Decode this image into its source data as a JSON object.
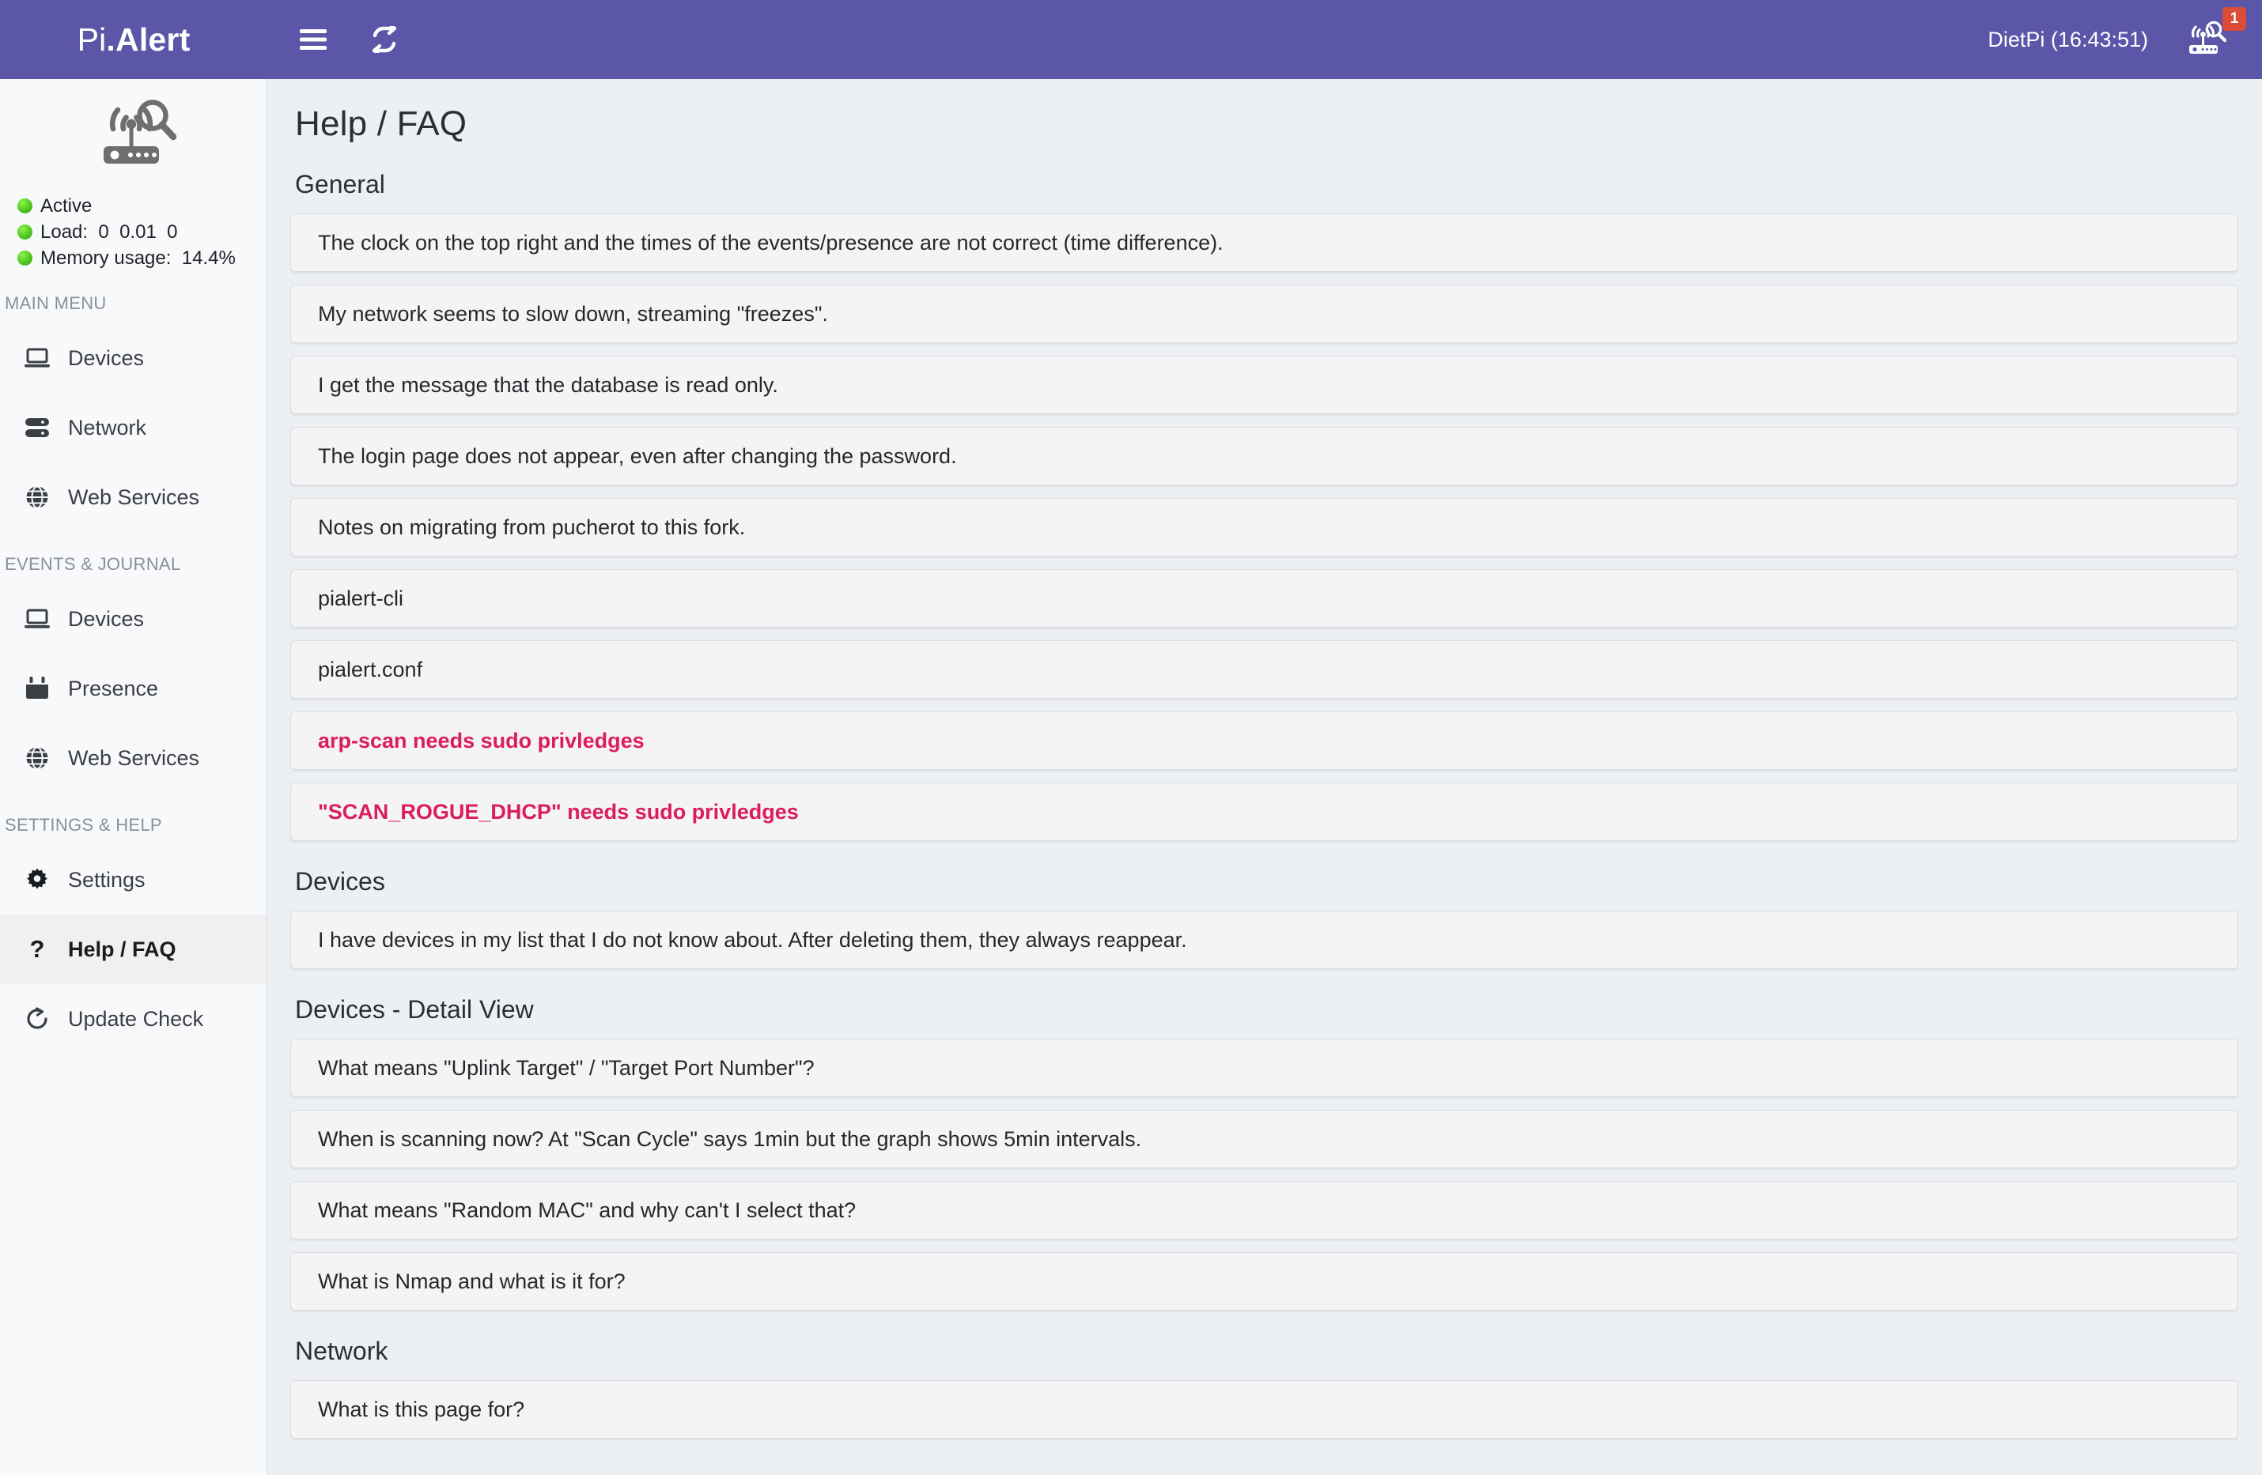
{
  "header": {
    "brand_light": "Pi",
    "brand_bold": ".Alert",
    "menu_toggle_icon": "hamburger-icon",
    "refresh_icon": "repeat-icon",
    "user_label": "DietPi (16:43:51)",
    "notification_icon": "router-scan-icon",
    "notification_count": "1"
  },
  "sidebar": {
    "logo_icon": "router-scan-logo",
    "status": [
      {
        "label": "Active",
        "color": "#4ec820"
      },
      {
        "label": "Load:  0  0.01  0",
        "color": "#4ec820"
      },
      {
        "label": "Memory usage:  14.4%",
        "color": "#4ec820"
      }
    ],
    "groups": [
      {
        "header": "MAIN MENU",
        "items": [
          {
            "label": "Devices",
            "icon": "laptop-icon",
            "active": false
          },
          {
            "label": "Network",
            "icon": "server-icon",
            "active": false
          },
          {
            "label": "Web Services",
            "icon": "globe-icon",
            "active": false
          }
        ]
      },
      {
        "header": "EVENTS & JOURNAL",
        "items": [
          {
            "label": "Devices",
            "icon": "laptop-icon",
            "active": false
          },
          {
            "label": "Presence",
            "icon": "calendar-icon",
            "active": false
          },
          {
            "label": "Web Services",
            "icon": "globe-icon",
            "active": false
          }
        ]
      },
      {
        "header": "SETTINGS & HELP",
        "items": [
          {
            "label": "Settings",
            "icon": "gear-icon",
            "active": false
          },
          {
            "label": "Help / FAQ",
            "icon": "question-mark-icon",
            "active": true
          },
          {
            "label": "Update Check",
            "icon": "refresh-cw-icon",
            "active": false
          }
        ]
      }
    ]
  },
  "main": {
    "page_title": "Help / FAQ",
    "sections": [
      {
        "title": "General",
        "items": [
          {
            "text": "The clock on the top right and the times of the events/presence are not correct (time difference).",
            "alert": false
          },
          {
            "text": "My network seems to slow down, streaming \"freezes\".",
            "alert": false
          },
          {
            "text": "I get the message that the database is read only.",
            "alert": false
          },
          {
            "text": "The login page does not appear, even after changing the password.",
            "alert": false
          },
          {
            "text": "Notes on migrating from pucherot to this fork.",
            "alert": false
          },
          {
            "text": "pialert-cli",
            "alert": false
          },
          {
            "text": "pialert.conf",
            "alert": false
          },
          {
            "text": "arp-scan needs sudo privledges",
            "alert": true
          },
          {
            "text": "\"SCAN_ROGUE_DHCP\" needs sudo privledges",
            "alert": true
          }
        ]
      },
      {
        "title": "Devices",
        "items": [
          {
            "text": "I have devices in my list that I do not know about. After deleting them, they always reappear.",
            "alert": false
          }
        ]
      },
      {
        "title": "Devices - Detail View",
        "items": [
          {
            "text": "What means \"Uplink Target\" / \"Target Port Number\"?",
            "alert": false
          },
          {
            "text": "When is scanning now? At \"Scan Cycle\" says 1min but the graph shows 5min intervals.",
            "alert": false
          },
          {
            "text": "What means \"Random MAC\" and why can't I select that?",
            "alert": false
          },
          {
            "text": "What is Nmap and what is it for?",
            "alert": false
          }
        ]
      },
      {
        "title": "Network",
        "items": [
          {
            "text": "What is this page for?",
            "alert": false
          }
        ]
      }
    ]
  },
  "colors": {
    "header_purple": "#5c56a8",
    "content_bg": "#ecf0f5",
    "sidebar_bg": "#f8f9fb",
    "alert_pink": "#dd1b60",
    "badge_red": "#dd4b39",
    "status_green": "#4ec820"
  }
}
